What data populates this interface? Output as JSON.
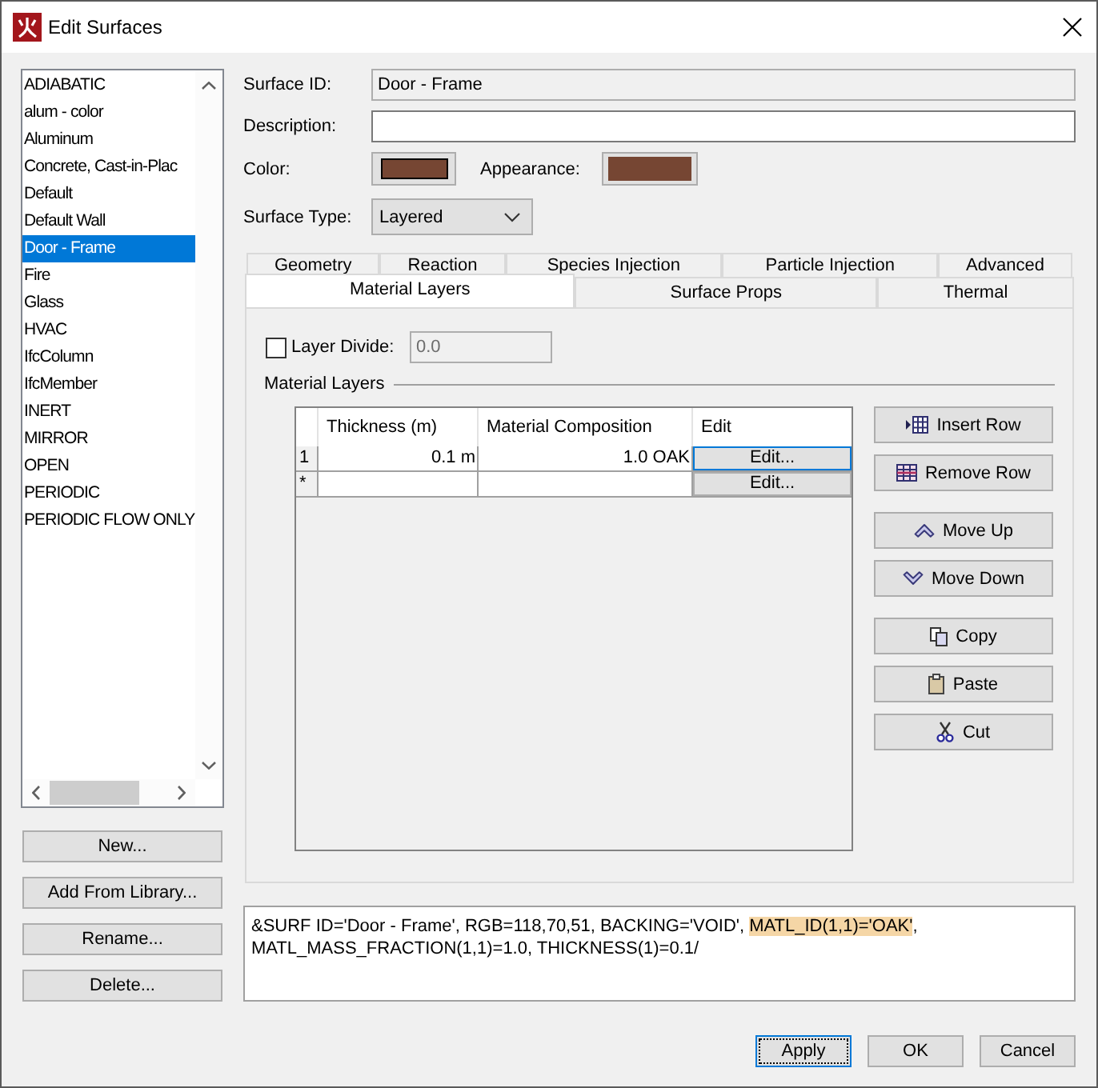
{
  "window": {
    "title": "Edit Surfaces"
  },
  "surface_list": {
    "items": [
      {
        "label": "ADIABATIC",
        "selected": false
      },
      {
        "label": "alum - color",
        "selected": false
      },
      {
        "label": "Aluminum",
        "selected": false
      },
      {
        "label": "Concrete, Cast-in-Plac",
        "selected": false
      },
      {
        "label": "Default",
        "selected": false
      },
      {
        "label": "Default Wall",
        "selected": false
      },
      {
        "label": "Door - Frame",
        "selected": true
      },
      {
        "label": "Fire",
        "selected": false
      },
      {
        "label": "Glass",
        "selected": false
      },
      {
        "label": "HVAC",
        "selected": false
      },
      {
        "label": "IfcColumn",
        "selected": false
      },
      {
        "label": "IfcMember",
        "selected": false
      },
      {
        "label": "INERT",
        "selected": false
      },
      {
        "label": "MIRROR",
        "selected": false
      },
      {
        "label": "OPEN",
        "selected": false
      },
      {
        "label": "PERIODIC",
        "selected": false
      },
      {
        "label": "PERIODIC FLOW ONLY",
        "selected": false
      }
    ]
  },
  "list_buttons": [
    "New...",
    "Add From Library...",
    "Rename...",
    "Delete..."
  ],
  "form": {
    "surface_id": {
      "label": "Surface ID:",
      "value": "Door - Frame",
      "disabled": true
    },
    "description": {
      "label": "Description:",
      "disabled": false
    },
    "color": {
      "label": "Color:",
      "color": "#764633"
    },
    "appearance": {
      "label": "Appearance:",
      "color": "#764633"
    },
    "surface_type": {
      "label": "Surface Type:",
      "value": "Layered"
    }
  },
  "tabs": {
    "upper_row": [
      {
        "label": "Geometry",
        "selected": false
      },
      {
        "label": "Reaction",
        "selected": false
      },
      {
        "label": "Species Injection",
        "selected": false
      },
      {
        "label": "Particle Injection",
        "selected": false
      },
      {
        "label": "Advanced",
        "selected": false
      }
    ],
    "lower_row": [
      {
        "label": "Material Layers",
        "selected": true
      },
      {
        "label": "Surface Props",
        "selected": false
      },
      {
        "label": "Thermal",
        "selected": false
      }
    ]
  },
  "material_layers_panel": {
    "layer_divide": {
      "label": "Layer Divide:",
      "checked": false,
      "value": "0.0",
      "disabled": true
    },
    "group_title": "Material Layers",
    "table": {
      "columns": [
        "Thickness (m)",
        "Material Composition",
        "Edit"
      ],
      "rows": [
        {
          "row_header": "1",
          "thickness": "0.1 m",
          "material_composition": "1.0 OAK",
          "edit_button": "Edit...",
          "focused": true
        },
        {
          "row_header": "*",
          "edit_button": "Edit...",
          "focused": false
        }
      ]
    },
    "buttons": [
      [
        {
          "label": "Insert Row",
          "kind": "insert-row"
        },
        {
          "label": "Remove Row",
          "kind": "remove-row"
        }
      ],
      [
        {
          "label": "Move Up",
          "kind": "move-up"
        },
        {
          "label": "Move Down",
          "kind": "move-down"
        }
      ],
      [
        {
          "label": "Copy",
          "kind": "copy"
        },
        {
          "label": "Paste",
          "kind": "paste"
        },
        {
          "label": "Cut",
          "kind": "cut"
        }
      ]
    ]
  },
  "namelist": {
    "lines": [
      [
        {
          "text": "&SURF ID='Door - Frame', RGB=118,70,51, BACKING='VOID', ",
          "highlighted": false
        },
        {
          "text": "MATL_ID(1,1)='OAK'",
          "highlighted": true
        },
        {
          "text": ",",
          "highlighted": false
        }
      ],
      [
        {
          "text": "MATL_MASS_FRACTION(1,1)=1.0, THICKNESS(1)=0.1/",
          "highlighted": false
        }
      ]
    ]
  },
  "dialog_buttons": [
    {
      "label": "Apply",
      "focused": true
    },
    {
      "label": "OK",
      "focused": false
    },
    {
      "label": "Cancel",
      "focused": false
    }
  ]
}
